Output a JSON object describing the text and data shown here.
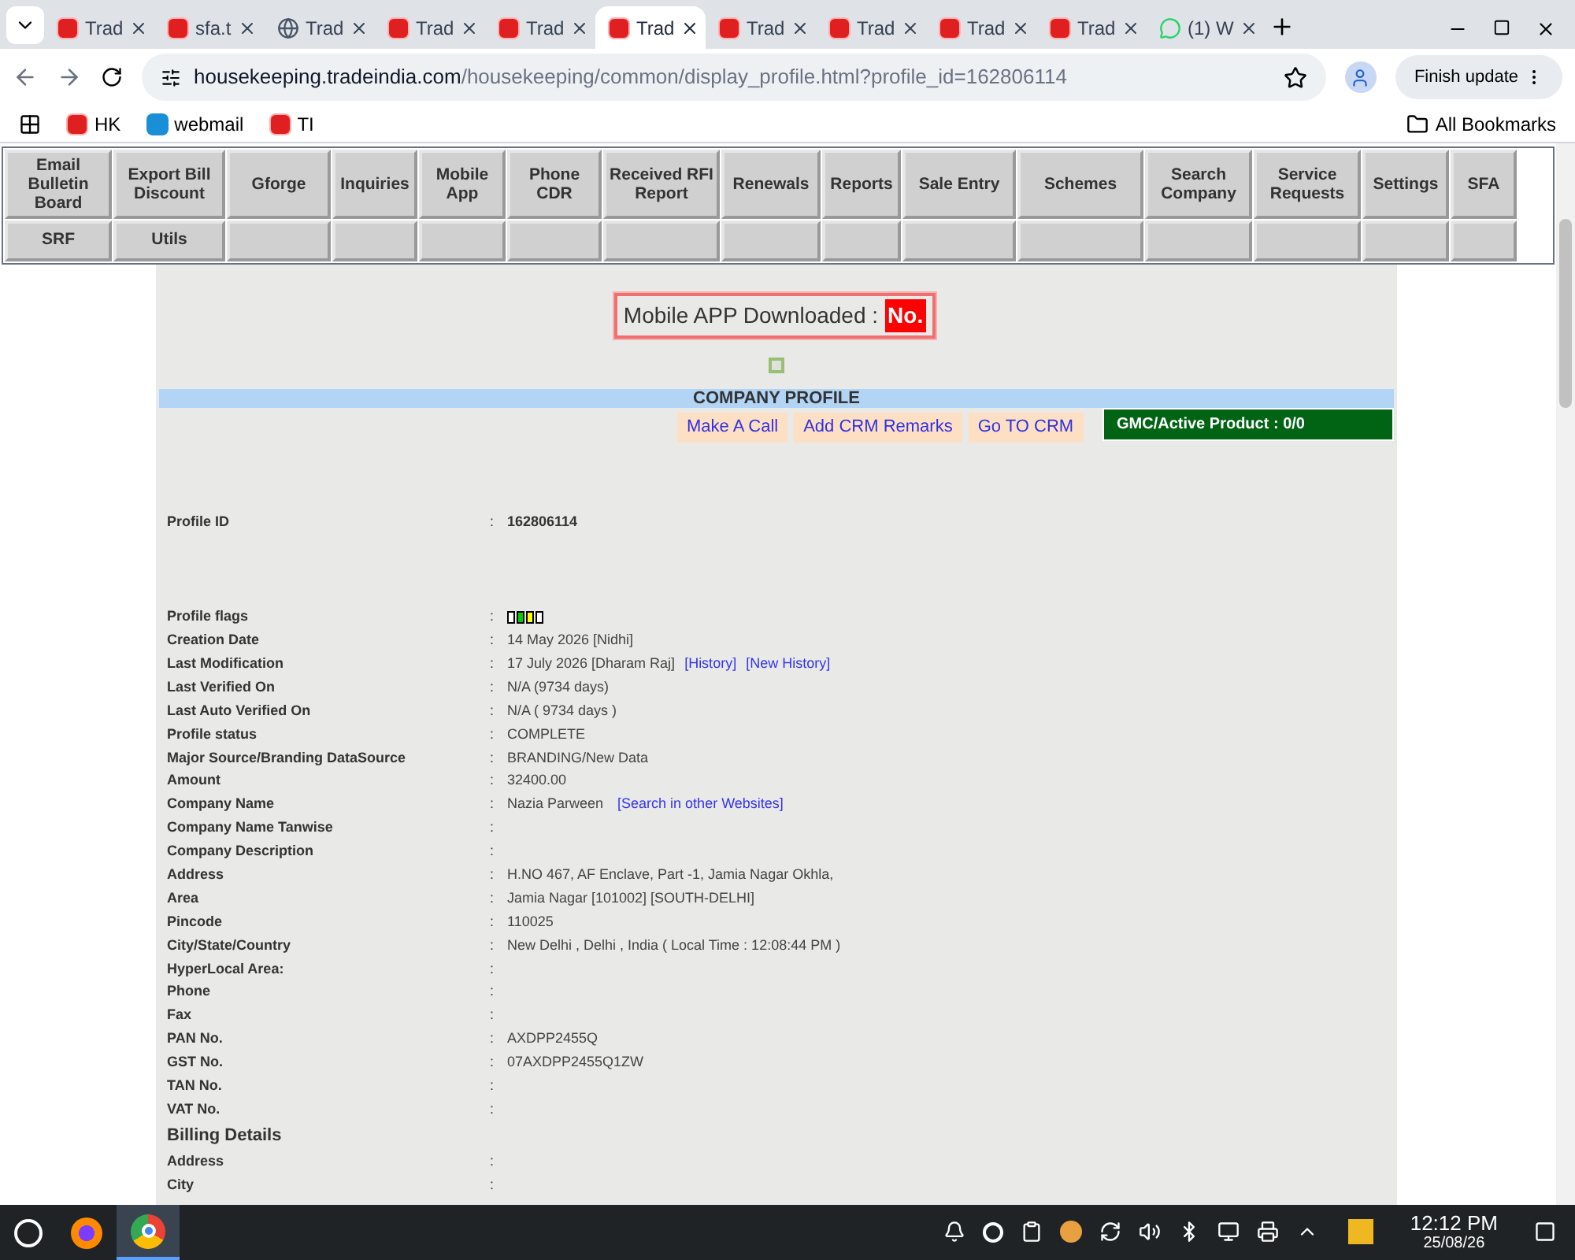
{
  "browser": {
    "tabs": [
      {
        "title": "Trad",
        "kind": "ti",
        "selected": false
      },
      {
        "title": "sfa.t",
        "kind": "ti",
        "selected": false
      },
      {
        "title": "Trad",
        "kind": "globe",
        "selected": false
      },
      {
        "title": "Trad",
        "kind": "ti",
        "selected": false
      },
      {
        "title": "Trad",
        "kind": "ti",
        "selected": false
      },
      {
        "title": "Trad",
        "kind": "ti",
        "selected": true
      },
      {
        "title": "Trad",
        "kind": "ti",
        "selected": false
      },
      {
        "title": "Trad",
        "kind": "ti",
        "selected": false
      },
      {
        "title": "Trad",
        "kind": "ti",
        "selected": false
      },
      {
        "title": "Trad",
        "kind": "ti",
        "selected": false
      },
      {
        "title": "(1) W",
        "kind": "chat",
        "selected": false
      }
    ],
    "url_host": "housekeeping.tradeindia.com",
    "url_path": "/housekeeping/common/display_profile.html?profile_id=162806114",
    "update_button": "Finish update",
    "bookmarks": [
      {
        "label": "HK",
        "kind": "ti"
      },
      {
        "label": "webmail",
        "kind": "z"
      },
      {
        "label": "TI",
        "kind": "ti"
      }
    ],
    "all_bookmarks": "All Bookmarks"
  },
  "nav": {
    "row_1": [
      "Email Bulletin Board",
      "Export Bill Discount",
      "Gforge",
      "Inquiries",
      "Mobile App",
      "Phone CDR",
      "Received RFI Report",
      "Renewals",
      "Reports",
      "Sale Entry",
      "Schemes",
      "Search Company",
      "Service Requests",
      "Settings",
      "SFA"
    ],
    "row_2": [
      "SRF",
      "Utils"
    ]
  },
  "app_notice": {
    "label": "Mobile APP Downloaded :",
    "value": "No."
  },
  "section_title": "COMPANY PROFILE",
  "actions": [
    "Make A Call",
    "Add CRM Remarks",
    "Go TO CRM"
  ],
  "gmc": "GMC/Active Product : 0/0",
  "rows": [
    {
      "kind": "id",
      "label": "Profile ID",
      "value": "162806114"
    },
    {
      "kind": "flags",
      "label": "Profile flags",
      "flags": [
        {
          "color": "#ffffff"
        },
        {
          "color": "#00cc00"
        },
        {
          "color": "#ffff00"
        },
        {
          "color": "#ffffff"
        }
      ]
    },
    {
      "kind": "field",
      "label": "Creation Date",
      "value": "14 May 2026 [Nidhi]"
    },
    {
      "kind": "field",
      "label": "Last Modification",
      "value": "17 July 2026 [Dharam Raj]",
      "links": [
        "[History]",
        "[New History]"
      ]
    },
    {
      "kind": "field",
      "label": "Last Verified On",
      "value": "N/A (9734 days)"
    },
    {
      "kind": "field",
      "label": "Last Auto Verified On",
      "value": "N/A ( 9734 days )"
    },
    {
      "kind": "field",
      "label": "Profile status",
      "value": "COMPLETE"
    },
    {
      "kind": "field",
      "label": "Major Source/Branding DataSource",
      "value": "BRANDING/New Data"
    },
    {
      "kind": "field",
      "label": "Amount",
      "value": "32400.00"
    },
    {
      "kind": "field",
      "label": "Company Name",
      "value": "Nazia Parween",
      "links": [
        "[Search in other Websites]"
      ]
    },
    {
      "kind": "field",
      "label": "Company Name Tanwise"
    },
    {
      "kind": "field",
      "label": "Company Description"
    },
    {
      "kind": "field",
      "label": "Address",
      "value": "H.NO 467, AF Enclave, Part -1, Jamia Nagar Okhla,"
    },
    {
      "kind": "field",
      "label": "Area",
      "value": "Jamia Nagar [101002] [SOUTH-DELHI]"
    },
    {
      "kind": "field",
      "label": "Pincode",
      "value": "110025"
    },
    {
      "kind": "field",
      "label": "City/State/Country",
      "value": "New Delhi , Delhi , India ( Local Time : 12:08:44 PM )"
    },
    {
      "kind": "field",
      "label": "HyperLocal Area:"
    },
    {
      "kind": "field",
      "label": "Phone"
    },
    {
      "kind": "field",
      "label": "Fax"
    },
    {
      "kind": "field",
      "label": "PAN No.",
      "value": "AXDPP2455Q"
    },
    {
      "kind": "field",
      "label": "GST No.",
      "value": "07AXDPP2455Q1ZW"
    },
    {
      "kind": "field",
      "label": "TAN No."
    },
    {
      "kind": "field",
      "label": "VAT No."
    },
    {
      "kind": "heading",
      "label": "Billing Details"
    },
    {
      "kind": "field",
      "label": "Address"
    },
    {
      "kind": "field",
      "label": "City"
    }
  ],
  "separator": ":",
  "clock": {
    "time": "12:12 PM",
    "date": "25/08/26"
  }
}
